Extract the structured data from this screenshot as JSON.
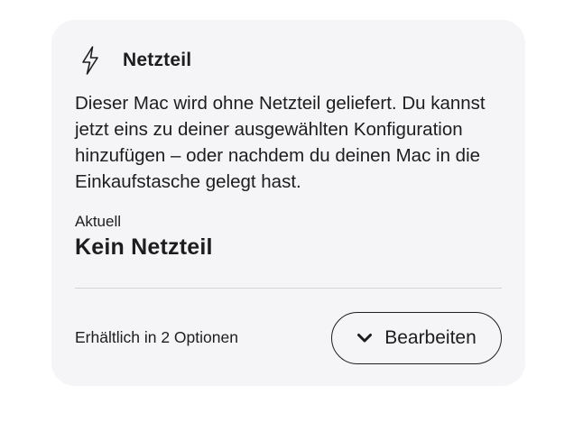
{
  "card": {
    "icon": "lightning-bolt-icon",
    "title": "Netzteil",
    "description": "Dieser Mac wird ohne Netzteil geliefert. Du kannst jetzt eins zu deiner ausgewählten Konfiguration hinzufügen – oder nachdem du deinen Mac in die Einkaufstasche gelegt hast.",
    "current_label": "Aktuell",
    "current_value": "Kein Netzteil",
    "availability": "Erhältlich in 2 Optionen",
    "edit_button": {
      "icon": "chevron-down-icon",
      "label": "Bearbeiten"
    }
  },
  "colors": {
    "card_background": "#f5f5f7",
    "text": "#1d1d1f",
    "divider": "#d2d2d7"
  }
}
